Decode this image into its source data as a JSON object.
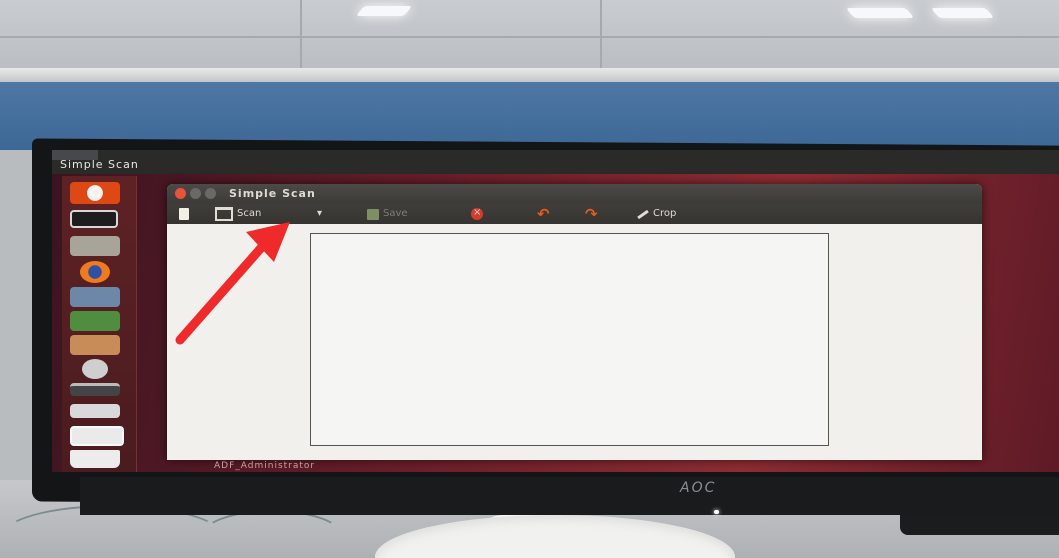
{
  "window": {
    "panel_title": "Simple Scan",
    "title": "Simple Scan"
  },
  "toolbar": {
    "scan_label": "Scan",
    "scan_dropdown": "▾",
    "save_label": "Save",
    "rotate_left": "↶",
    "rotate_right": "↷",
    "crop_label": "Crop"
  },
  "taskbar": {
    "caption": "ADF_Administrator"
  },
  "monitor": {
    "brand": "AOC"
  },
  "colors": {
    "annotation_arrow": "#ef2a2a",
    "close_button": "#e7533b",
    "ubuntu_accent": "#dd4814"
  },
  "icons": [
    "ubuntu-dash-icon",
    "terminal-icon",
    "files-icon",
    "firefox-icon",
    "writer-icon",
    "calc-icon",
    "impress-icon",
    "settings-icon",
    "scanner-icon",
    "printer-icon",
    "trash-icon"
  ]
}
